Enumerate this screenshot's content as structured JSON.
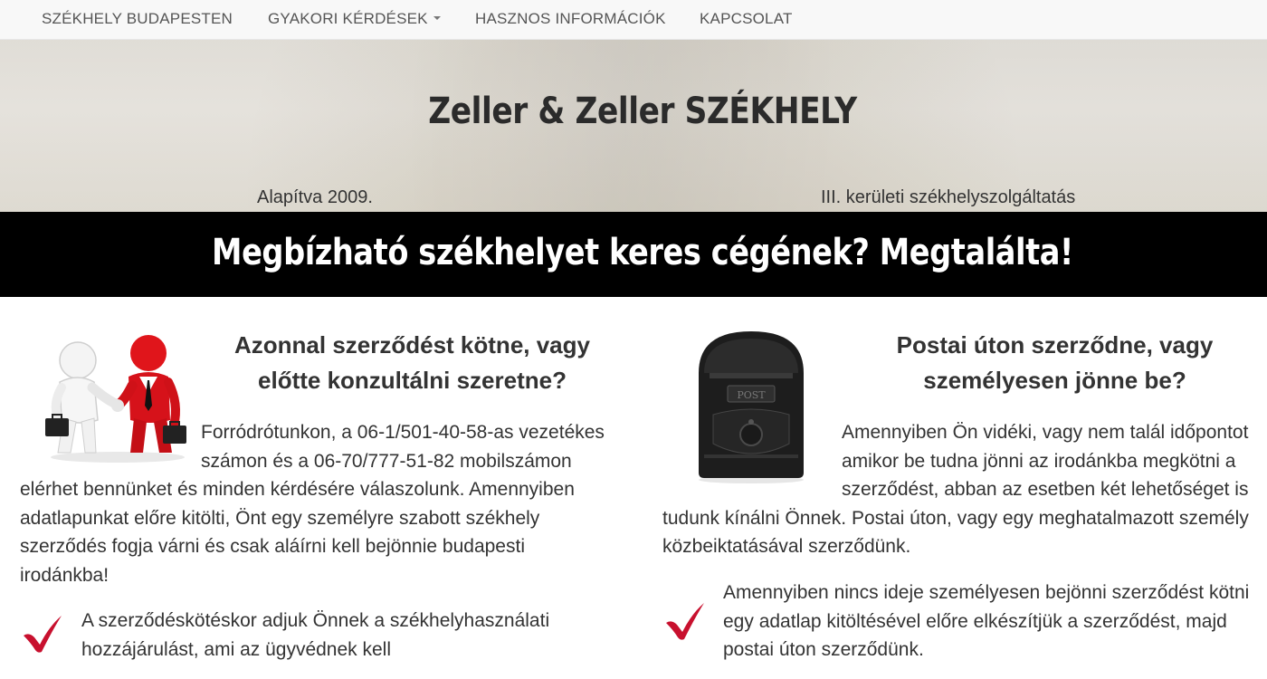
{
  "nav": {
    "items": [
      "SZÉKHELY BUDAPESTEN",
      "GYAKORI KÉRDÉSEK",
      "HASZNOS INFORMÁCIÓK",
      "KAPCSOLAT"
    ]
  },
  "hero": {
    "title": "Zeller & Zeller SZÉKHELY",
    "founded": "Alapítva 2009.",
    "district": "III. kerületi székhelyszolgáltatás"
  },
  "banner": {
    "text": "Megbízható székhelyet keres cégének? Megtalálta!"
  },
  "left": {
    "heading": "Azonnal szerződést kötne, vagy előtte konzultálni szeretne?",
    "paragraph": "Forródrótunkon, a 06-1/501-40-58-as vezetékes számon és a 06-70/777-51-82 mobilszámon elérhet bennünket és minden kérdésére válaszolunk. Amennyiben adatlapunkat előre kitölti, Önt egy személyre szabott székhely szerződés fogja várni és csak aláírni kell bejönnie budapesti irodánkba!",
    "check_text": "A szerződéskötéskor adjuk Önnek a székhelyhasználati hozzájárulást, ami az ügyvédnek kell",
    "image_icon": "handshake-illustration"
  },
  "right": {
    "heading": "Postai úton szerződne, vagy személyesen jönne be?",
    "paragraph": "Amennyiben Ön vidéki, vagy nem talál időpontot amikor be tudna jönni az irodánkba megkötni a szerződést, abban az esetben két lehetőséget is tudunk kínálni Önnek. Postai úton, vagy egy meghatalmazott személy közbeiktatásával szerződünk.",
    "check_text": "Amennyiben nincs ideje személyesen bejönni szerződést kötni egy adatlap kitöltésével előre elkészítjük a szerződést, majd postai úton szerződünk.",
    "image_icon": "mailbox-illustration",
    "mailbox_label": "POST"
  },
  "colors": {
    "navbar_bg": "#f8f8f8",
    "banner_bg": "#000000",
    "check_red": "#c8102e",
    "figure_red": "#e0151b"
  }
}
